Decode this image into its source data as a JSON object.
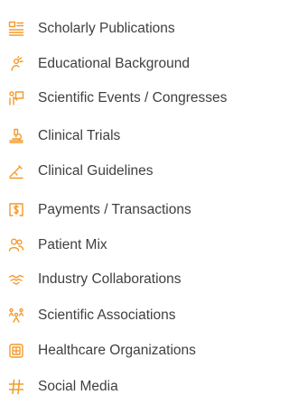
{
  "accent_color": "#f39a2d",
  "text_color": "#3f3f3f",
  "menu": {
    "items": [
      {
        "label": "Scholarly Publications",
        "icon": "publications-icon"
      },
      {
        "label": "Educational Background",
        "icon": "education-icon"
      },
      {
        "label": "Scientific Events / Congresses",
        "icon": "events-icon"
      },
      {
        "label": "Clinical Trials",
        "icon": "microscope-icon"
      },
      {
        "label": "Clinical Guidelines",
        "icon": "guidelines-icon"
      },
      {
        "label": "Payments / Transactions",
        "icon": "payments-icon"
      },
      {
        "label": "Patient Mix",
        "icon": "patients-icon"
      },
      {
        "label": "Industry Collaborations",
        "icon": "handshake-icon"
      },
      {
        "label": "Scientific Associations",
        "icon": "associations-icon"
      },
      {
        "label": "Healthcare Organizations",
        "icon": "hospital-icon"
      },
      {
        "label": "Social Media",
        "icon": "hash-icon"
      }
    ]
  }
}
